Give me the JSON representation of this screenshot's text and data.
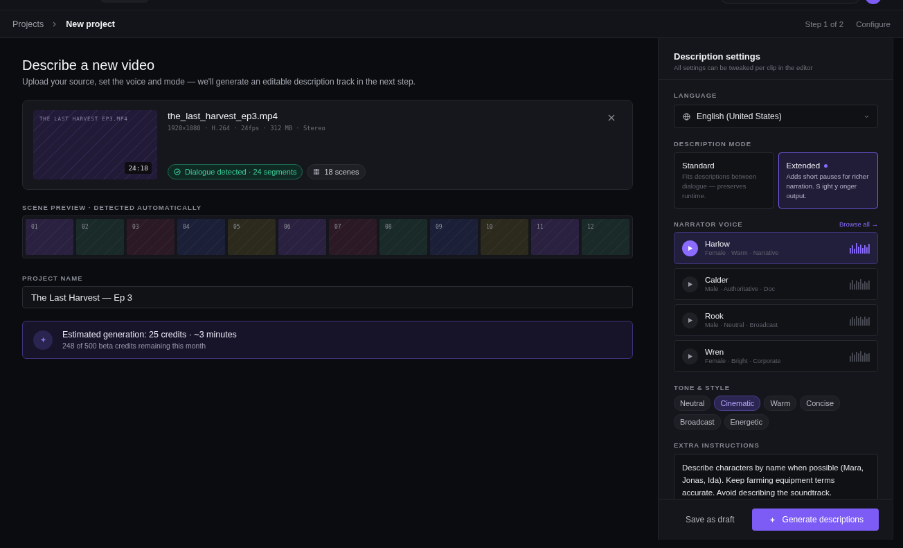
{
  "breadcrumb": {
    "items": [
      "Projects",
      "New project"
    ],
    "step": "Step 1 of 2",
    "action": "Configure"
  },
  "page": {
    "title": "Describe a new video",
    "subtitle": "Upload your source, set the voice and mode — we'll generate an editable description track in the next step."
  },
  "file": {
    "thumbnail_label": "THE LAST HARVEST EP3.MP4",
    "duration": "24:18",
    "name": "the_last_harvest_ep3.mp4",
    "meta": "1920×1080 · H.264 · 24fps · 312 MB · Stereo",
    "badges": [
      {
        "kind": "success",
        "label": "Dialogue detected · 24 segments"
      },
      {
        "kind": "neutral",
        "label": "18 scenes"
      }
    ]
  },
  "scene_preview": {
    "label": "SCENE PREVIEW · DETECTED AUTOMATICALLY",
    "scenes": [
      {
        "label": "01",
        "color": "#2a2140"
      },
      {
        "label": "02",
        "color": "#1a2a29"
      },
      {
        "label": "03",
        "color": "#2b1a25"
      },
      {
        "label": "04",
        "color": "#1b2038"
      },
      {
        "label": "05",
        "color": "#2b2a1c"
      },
      {
        "label": "06",
        "color": "#2a2140"
      },
      {
        "label": "07",
        "color": "#2b1a25"
      },
      {
        "label": "08",
        "color": "#1a2a29"
      },
      {
        "label": "09",
        "color": "#1b2038"
      },
      {
        "label": "10",
        "color": "#2b2a1c"
      },
      {
        "label": "11",
        "color": "#2a2140"
      },
      {
        "label": "12",
        "color": "#1a2a29"
      }
    ]
  },
  "project_name": {
    "label": "PROJECT NAME",
    "value": "The Last Harvest — Ep 3"
  },
  "estimate": {
    "title": "Estimated generation: 25 credits · ~3 minutes",
    "subtitle": "248 of 500 beta credits remaining this month"
  },
  "settings": {
    "title": "Description settings",
    "subtitle": "All settings can be tweaked per clip in the editor",
    "language": {
      "label": "LANGUAGE",
      "value": "English (United States)"
    },
    "mode": {
      "label": "DESCRIPTION MODE",
      "options": [
        {
          "title": "Standard",
          "description": "Fits descriptions between dialogue — preserves runtime.",
          "selected": false
        },
        {
          "title": "Extended",
          "description": "Adds short pauses for richer narration. S ight y onger output.",
          "selected": true
        }
      ]
    },
    "voice": {
      "label": "NARRATOR VOICE",
      "link": "Browse all →",
      "voices": [
        {
          "name": "Harlow",
          "traits": "Female · Warm · Narrative",
          "selected": true
        },
        {
          "name": "Calder",
          "traits": "Male · Authoritative · Doc",
          "selected": false
        },
        {
          "name": "Rook",
          "traits": "Male · Neutral · Broadcast",
          "selected": false
        },
        {
          "name": "Wren",
          "traits": "Female · Bright · Corporate",
          "selected": false
        }
      ]
    },
    "tone": {
      "label": "TONE & STYLE",
      "chips": [
        {
          "label": "Neutral",
          "selected": false
        },
        {
          "label": "Cinematic",
          "selected": true
        },
        {
          "label": "Warm",
          "selected": false
        },
        {
          "label": "Concise",
          "selected": false
        },
        {
          "label": "Broadcast",
          "selected": false
        },
        {
          "label": "Energetic",
          "selected": false
        }
      ]
    },
    "instructions": {
      "label": "EXTRA INSTRUCTIONS",
      "value": "Describe characters by name when possible (Mara, Jonas, Ida). Keep farming equipment terms accurate. Avoid describing the soundtrack."
    },
    "footer": {
      "secondary": "Save as draft",
      "primary": "Generate descriptions"
    }
  }
}
